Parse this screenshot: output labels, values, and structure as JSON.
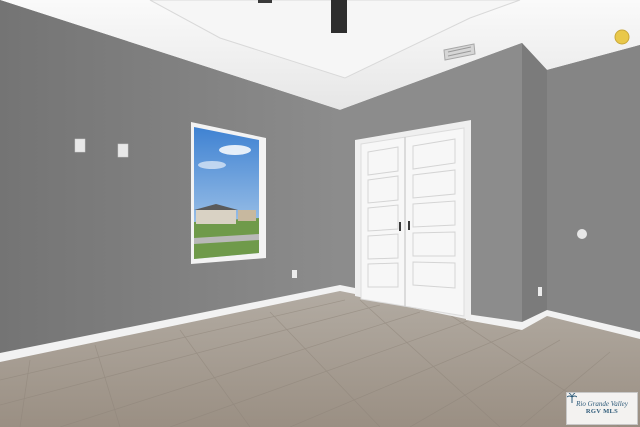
{
  "photo": {
    "subject": "empty-bedroom-interior",
    "colors": {
      "wall_left": "#7f7f7f",
      "wall_back": "#8a8a8a",
      "ceiling": "#f1f1f1",
      "floor": "#a49a8e",
      "door": "#f5f5f5",
      "baseboard": "#f4f4f4",
      "sky": "#4f8fd6"
    }
  },
  "watermark": {
    "script_text": "Rio Grande Valley",
    "sub_text": "RGV MLS",
    "icon": "palm-tree-icon"
  }
}
